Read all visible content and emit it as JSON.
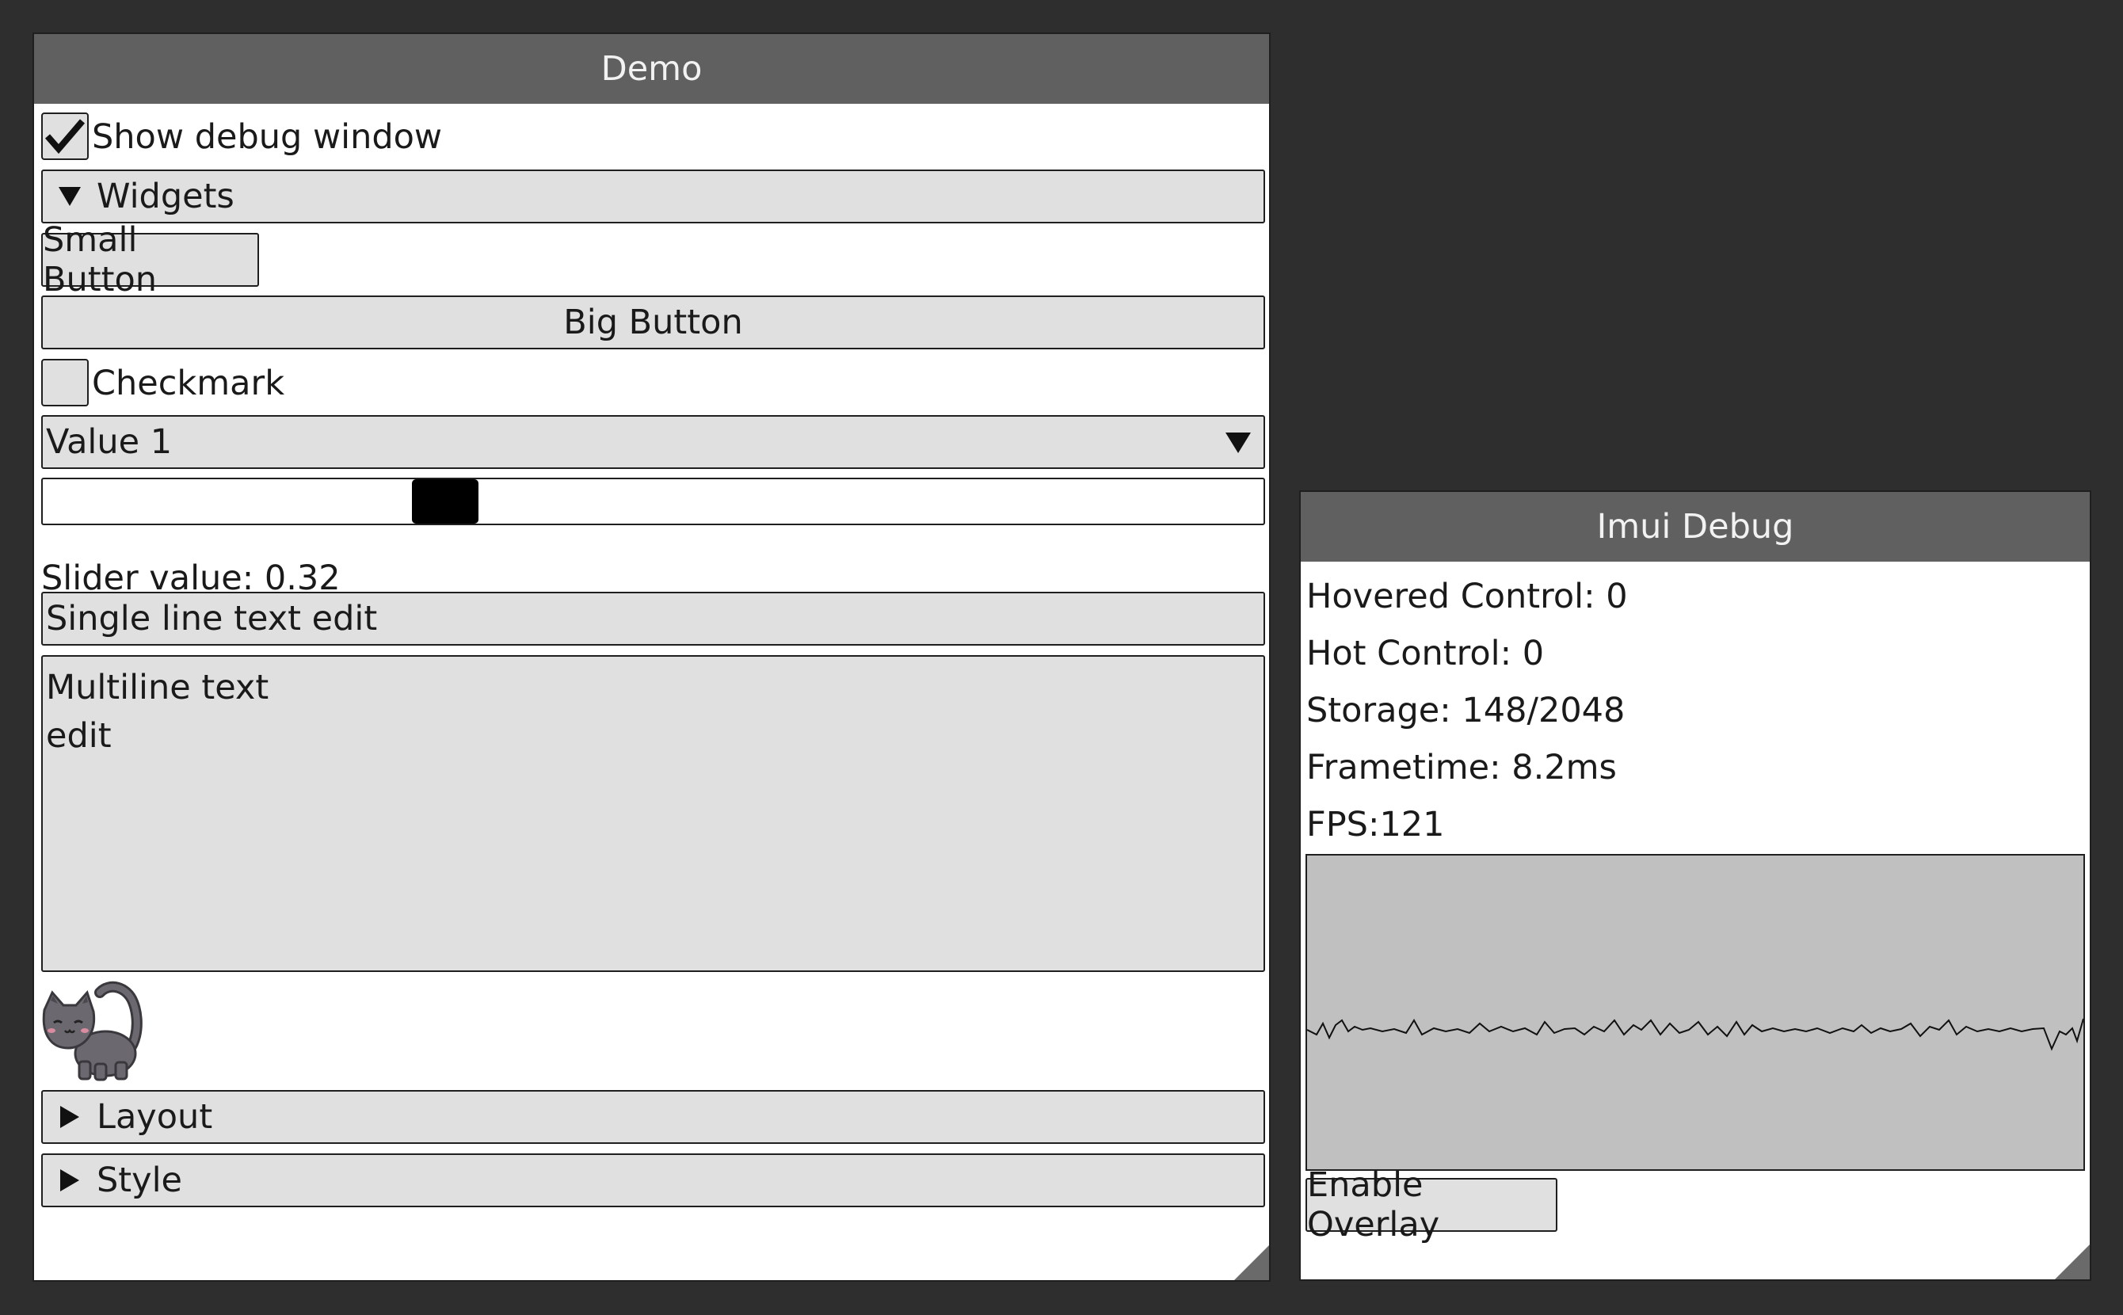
{
  "demo": {
    "title": "Demo",
    "show_debug_label": "Show debug window",
    "show_debug_checked": true,
    "widgets_header": "Widgets",
    "small_button": "Small Button",
    "big_button": "Big Button",
    "checkmark_label": "Checkmark",
    "checkmark_checked": false,
    "dropdown_value": "Value 1",
    "slider_value": 0.32,
    "slider_value_label": "Slider value: 0.32",
    "single_line_edit": "Single line text edit",
    "multiline_line1": "Multiline text",
    "multiline_line2": "edit",
    "layout_header": "Layout",
    "style_header": "Style"
  },
  "debug": {
    "title": "Imui Debug",
    "hovered_control": "Hovered Control: 0",
    "hot_control": "Hot Control: 0",
    "storage": "Storage: 148/2048",
    "frametime": "Frametime: 8.2ms",
    "fps": "FPS:121",
    "enable_overlay_button": "Enable Overlay"
  },
  "colors": {
    "background": "#2e2e2e",
    "title_bar": "#606060",
    "widget_fill": "#e0e0e0",
    "graph_fill": "#c0c0c0",
    "cat_body": "#6b6870"
  },
  "icons": {
    "checked": "checkmark-icon",
    "expanded": "triangle-down-icon",
    "collapsed": "triangle-right-icon",
    "dropdown": "triangle-down-icon",
    "mascot": "cat-icon",
    "resize": "resize-grip-icon"
  }
}
